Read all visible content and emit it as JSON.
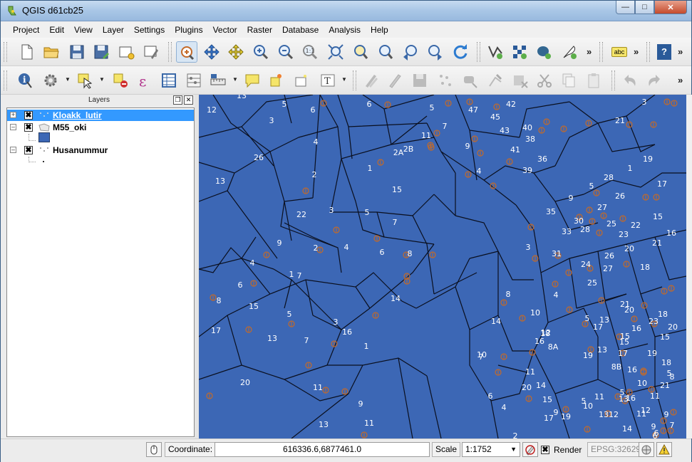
{
  "window": {
    "title": "QGIS d61cb25"
  },
  "menubar": {
    "items": [
      "Project",
      "Edit",
      "View",
      "Layer",
      "Settings",
      "Plugins",
      "Vector",
      "Raster",
      "Database",
      "Analysis",
      "Help"
    ]
  },
  "toolbar": {
    "label_tool": "abc",
    "help_tool": "?",
    "more": "»"
  },
  "layers_panel": {
    "title": "Layers",
    "layers": [
      {
        "name": "Kloakk_lutir",
        "checked": true,
        "expanded": false,
        "selected": true
      },
      {
        "name": "M55_oki",
        "checked": true,
        "expanded": true,
        "selected": false,
        "swatch_color": "#3c67b5"
      },
      {
        "name": "Husanummur",
        "checked": true,
        "expanded": true,
        "selected": false
      }
    ]
  },
  "map": {
    "background_color": "#3c67b5",
    "manhole_color": "#c46a28",
    "parcel_labels": [
      "13",
      "12",
      "5",
      "3",
      "6",
      "26",
      "4",
      "2",
      "1",
      "13",
      "22",
      "3",
      "5",
      "7",
      "9",
      "4",
      "2",
      "4",
      "6",
      "8",
      "1",
      "7",
      "6",
      "8",
      "15",
      "5",
      "3",
      "17",
      "13",
      "7",
      "16",
      "1",
      "20",
      "11",
      "14",
      "9",
      "13",
      "11",
      "15",
      "6",
      "5",
      "47",
      "42",
      "45",
      "43",
      "40",
      "38",
      "41",
      "39",
      "36",
      "2A",
      "2B",
      "11",
      "7",
      "9",
      "4",
      "3",
      "21",
      "19",
      "1",
      "28",
      "9",
      "5",
      "17",
      "26",
      "35",
      "30",
      "28",
      "27",
      "25",
      "22",
      "16",
      "15",
      "33",
      "23",
      "18",
      "20",
      "21",
      "31",
      "26",
      "24",
      "27",
      "25",
      "3",
      "8",
      "4",
      "10",
      "12",
      "14",
      "8A",
      "16",
      "5",
      "13",
      "19",
      "17",
      "21",
      "20",
      "23",
      "15",
      "18",
      "15",
      "17",
      "16",
      "18",
      "19",
      "20",
      "16",
      "15",
      "13",
      "8B",
      "10",
      "7",
      "18",
      "14",
      "11",
      "9",
      "6",
      "4",
      "2",
      "20",
      "15",
      "17",
      "19",
      "11",
      "13",
      "12",
      "10",
      "11",
      "9",
      "6",
      "5",
      "8",
      "12",
      "14",
      "11",
      "9",
      "7",
      "6",
      "5",
      "10",
      "13",
      "5",
      "21",
      "16"
    ]
  },
  "statusbar": {
    "coordinate_label": "Coordinate:",
    "coordinate_value": "616336.6,6877461.0",
    "scale_label": "Scale",
    "scale_value": "1:1752",
    "render_label": "Render",
    "render_checked": true,
    "crs": "EPSG:32629"
  }
}
